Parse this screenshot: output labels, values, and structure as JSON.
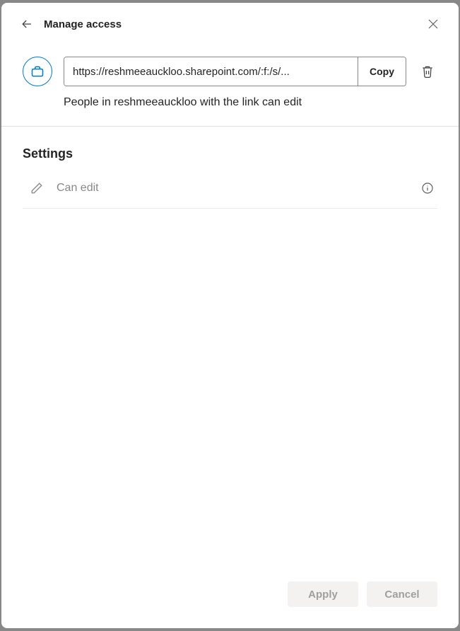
{
  "header": {
    "title": "Manage access"
  },
  "link": {
    "url": "https://reshmeeauckloo.sharepoint.com/:f:/s/...",
    "copy_label": "Copy",
    "description": "People in reshmeeauckloo with the link can edit"
  },
  "settings": {
    "title": "Settings",
    "permission_label": "Can edit"
  },
  "footer": {
    "apply_label": "Apply",
    "cancel_label": "Cancel"
  }
}
